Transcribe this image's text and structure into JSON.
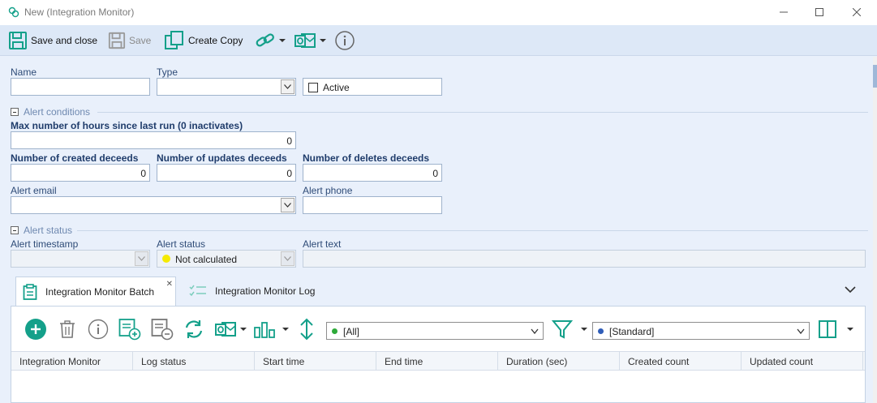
{
  "window": {
    "title": "New (Integration Monitor)",
    "minimize": "—",
    "maximize": "☐",
    "close": "✕"
  },
  "toolbar": {
    "save_close": "Save and close",
    "save": "Save",
    "create_copy": "Create Copy"
  },
  "form": {
    "name_label": "Name",
    "name_value": "",
    "type_label": "Type",
    "type_value": "",
    "active_label": "Active",
    "active_checked": false,
    "alert_conditions": {
      "section": "Alert conditions",
      "max_hours_label": "Max number of hours since last run (0 inactivates)",
      "max_hours_value": "0",
      "created_label": "Number of created deceeds",
      "created_value": "0",
      "updates_label": "Number of updates deceeds",
      "updates_value": "0",
      "deletes_label": "Number of deletes deceeds",
      "deletes_value": "0",
      "email_label": "Alert email",
      "email_value": "",
      "phone_label": "Alert phone",
      "phone_value": ""
    },
    "alert_status": {
      "section": "Alert status",
      "timestamp_label": "Alert timestamp",
      "timestamp_value": "",
      "status_label": "Alert status",
      "status_value": "Not calculated",
      "status_color": "#f5ea00",
      "text_label": "Alert text",
      "text_value": ""
    }
  },
  "tabs": [
    {
      "label": "Integration Monitor Batch",
      "active": true
    },
    {
      "label": "Integration Monitor Log",
      "active": false
    }
  ],
  "panel": {
    "filter_value": "[All]",
    "filter_color": "#2eaa3a",
    "view_value": "[Standard]",
    "view_color": "#2f5db8",
    "columns": [
      "Integration Monitor",
      "Log status",
      "Start time",
      "End time",
      "Duration (sec)",
      "Created count",
      "Updated count"
    ]
  },
  "colors": {
    "accent_teal": "#14a08a",
    "label_blue": "#2e4b77"
  }
}
